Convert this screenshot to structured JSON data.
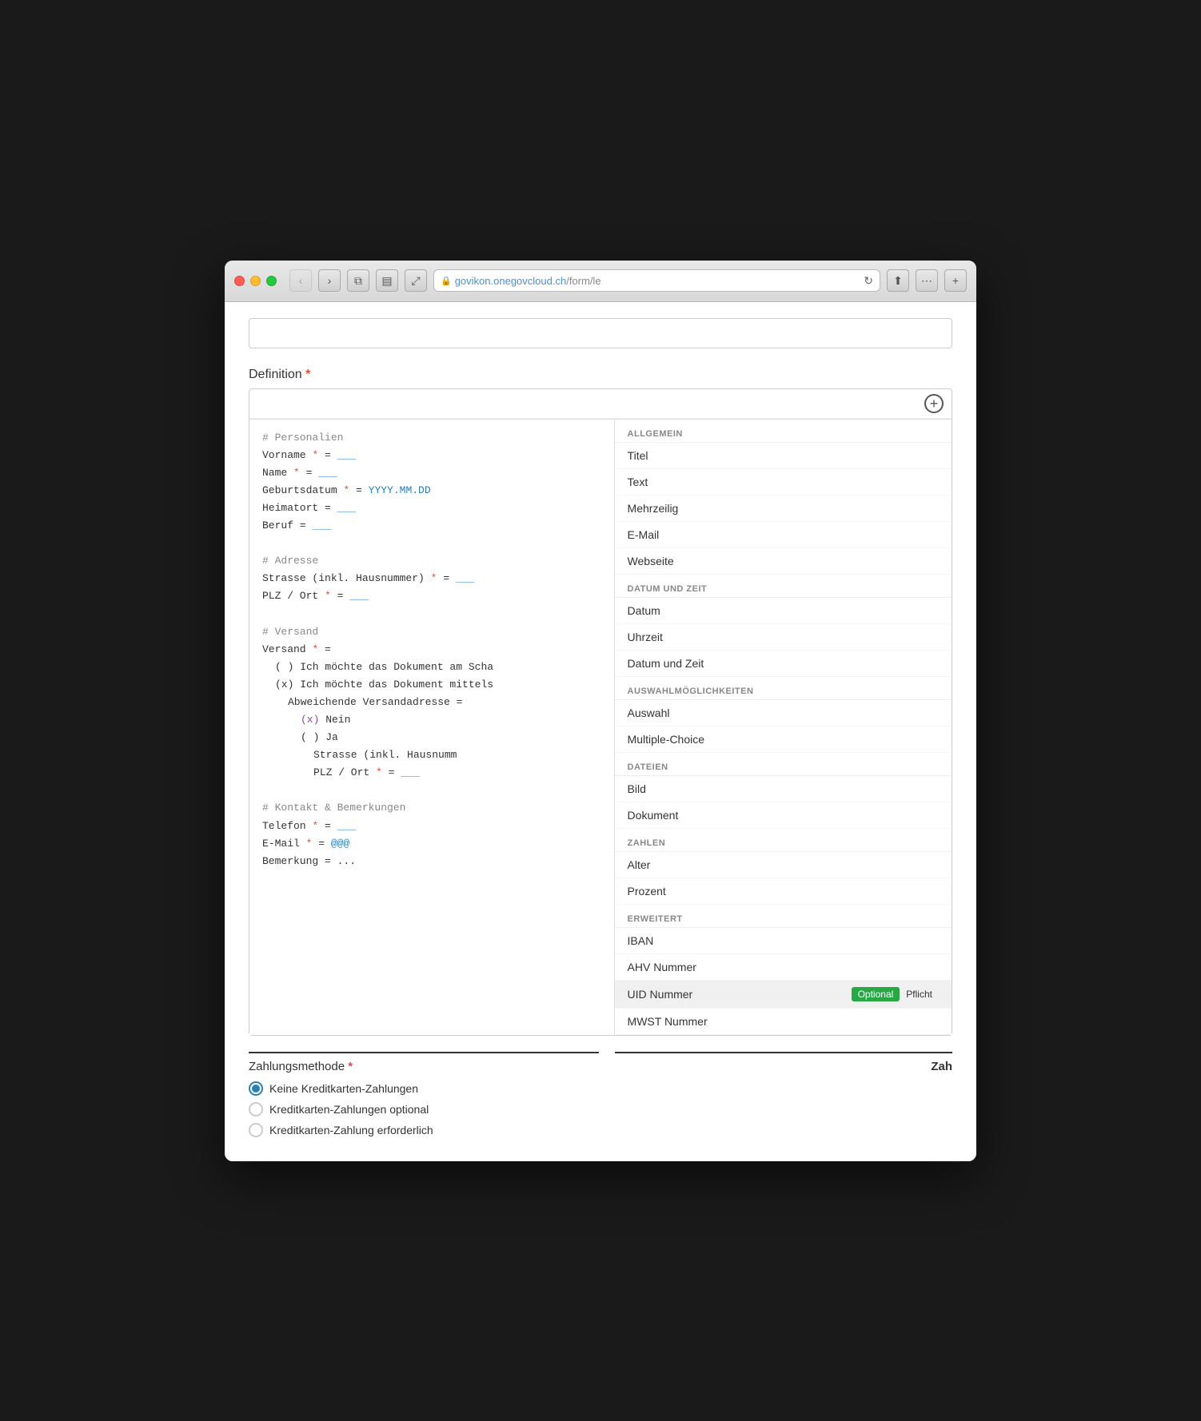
{
  "browser": {
    "url_prefix": "govikon.onegovcloud.ch",
    "url_path": "/form/le",
    "add_tab_label": "+"
  },
  "page": {
    "top_bar_placeholder": "",
    "definition_label": "Definition",
    "definition_required": "*",
    "code_lines": [
      {
        "indent": 0,
        "type": "comment",
        "text": "# Personalien"
      },
      {
        "indent": 0,
        "type": "field",
        "key": "Vorname",
        "star": true,
        "value": "___",
        "value_type": "blank"
      },
      {
        "indent": 0,
        "type": "field",
        "key": "Name",
        "star": true,
        "value": "___",
        "value_type": "blank"
      },
      {
        "indent": 0,
        "type": "field",
        "key": "Geburtsdatum",
        "star": true,
        "value": "YYYY.MM.DD",
        "value_type": "blue"
      },
      {
        "indent": 0,
        "type": "field",
        "key": "Heimatort",
        "star": false,
        "value": "___",
        "value_type": "blank"
      },
      {
        "indent": 0,
        "type": "field",
        "key": "Beruf",
        "star": false,
        "value": "___",
        "value_type": "blank"
      },
      {
        "indent": 0,
        "type": "empty"
      },
      {
        "indent": 0,
        "type": "comment",
        "text": "# Adresse"
      },
      {
        "indent": 0,
        "type": "field",
        "key": "Strasse (inkl. Hausnummer)",
        "star": true,
        "value": "___",
        "value_type": "blank"
      },
      {
        "indent": 0,
        "type": "field",
        "key": "PLZ / Ort",
        "star": true,
        "value": "___",
        "value_type": "blank"
      },
      {
        "indent": 0,
        "type": "empty"
      },
      {
        "indent": 0,
        "type": "comment",
        "text": "# Versand"
      },
      {
        "indent": 0,
        "type": "field_novalue",
        "key": "Versand",
        "star": true
      },
      {
        "indent": 1,
        "type": "radio_empty",
        "text": "( ) Ich möchte das Dokument am Scha"
      },
      {
        "indent": 1,
        "type": "radio_checked",
        "text": "(x) Ich möchte das Dokument mittels"
      },
      {
        "indent": 2,
        "type": "field",
        "key": "Abweichende Versandadresse",
        "star": false,
        "value": "",
        "value_type": "none"
      },
      {
        "indent": 3,
        "type": "radio_checked2",
        "text": "(x) Nein"
      },
      {
        "indent": 3,
        "type": "radio_empty2",
        "text": "( ) Ja"
      },
      {
        "indent": 4,
        "type": "field_trunc",
        "key": "Strasse (inkl. Hausnumm"
      },
      {
        "indent": 4,
        "type": "field_ort",
        "key": "PLZ / Ort",
        "star": true,
        "value": "___",
        "value_type": "blank"
      },
      {
        "indent": 0,
        "type": "empty"
      },
      {
        "indent": 0,
        "type": "comment",
        "text": "# Kontakt & Bemerkungen"
      },
      {
        "indent": 0,
        "type": "field",
        "key": "Telefon",
        "star": true,
        "value": "___",
        "value_type": "blank"
      },
      {
        "indent": 0,
        "type": "field",
        "key": "E-Mail",
        "star": true,
        "value": "@@@",
        "value_type": "blue"
      },
      {
        "indent": 0,
        "type": "field",
        "key": "Bemerkung",
        "star": false,
        "value": "...",
        "value_type": "blank"
      }
    ],
    "menu": {
      "sections": [
        {
          "id": "allgemein",
          "header": "ALLGEMEIN",
          "items": [
            "Titel",
            "Text",
            "Mehrzeilig",
            "E-Mail",
            "Webseite"
          ]
        },
        {
          "id": "datum",
          "header": "DATUM UND ZEIT",
          "items": [
            "Datum",
            "Uhrzeit",
            "Datum und Zeit"
          ]
        },
        {
          "id": "auswahl",
          "header": "AUSWAHLMÖGLICHKEITEN",
          "items": [
            "Auswahl",
            "Multiple-Choice"
          ]
        },
        {
          "id": "dateien",
          "header": "DATEIEN",
          "items": [
            "Bild",
            "Dokument"
          ]
        },
        {
          "id": "zahlen",
          "header": "ZAHLEN",
          "items": [
            "Alter",
            "Prozent"
          ]
        },
        {
          "id": "erweitert",
          "header": "ERWEITERT",
          "items": [
            "IBAN",
            "AHV Nummer",
            "UID Nummer",
            "MWST Nummer"
          ]
        }
      ],
      "highlighted_item": "UID Nummer",
      "badge_optional": "Optional",
      "badge_pflicht": "Pflicht"
    },
    "divider_right_label": "Zah",
    "zahlung": {
      "label": "Zahlungsmethode",
      "required": "*",
      "options": [
        {
          "id": "none",
          "label": "Keine Kreditkarten-Zahlungen",
          "selected": true
        },
        {
          "id": "optional",
          "label": "Kreditkarten-Zahlungen optional",
          "selected": false
        },
        {
          "id": "required",
          "label": "Kreditkarten-Zahlung erforderlich",
          "selected": false
        }
      ]
    }
  }
}
